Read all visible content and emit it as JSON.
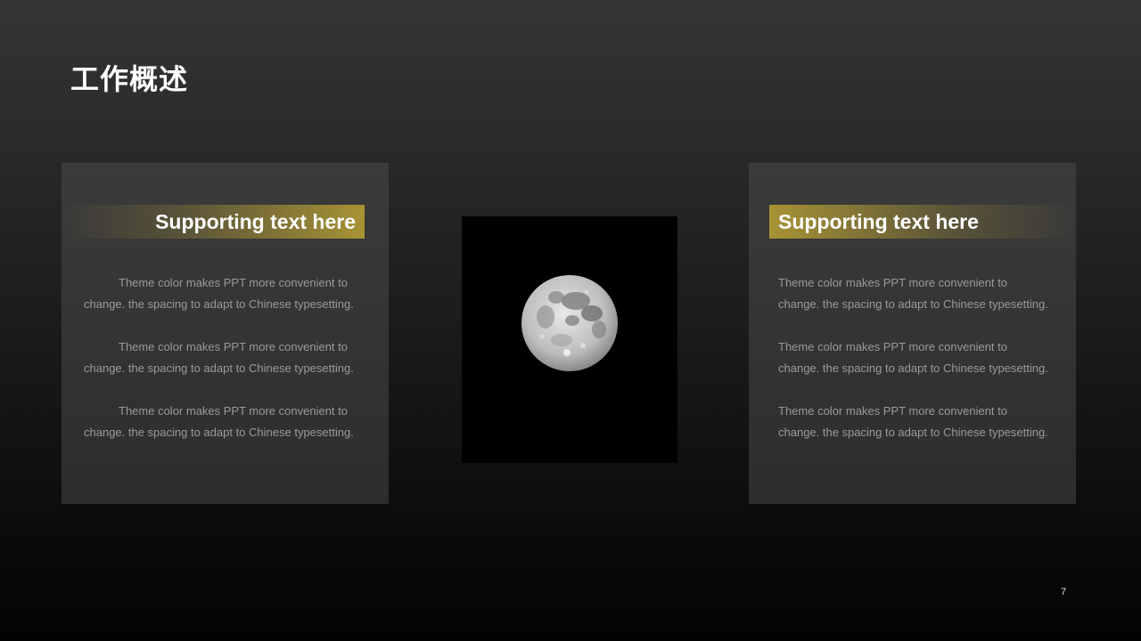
{
  "slide": {
    "title": "工作概述",
    "page_number": "7"
  },
  "left_panel": {
    "heading": "Supporting text here",
    "paragraphs": [
      {
        "line1": "Theme  color makes PPT more convenient  to",
        "line2": "change. the spacing to adapt to Chinese typesetting."
      },
      {
        "line1": "Theme  color makes PPT more convenient  to",
        "line2": "change. the spacing to adapt to Chinese typesetting."
      },
      {
        "line1": "Theme  color makes PPT more convenient  to",
        "line2": "change. the spacing to adapt to Chinese typesetting."
      }
    ]
  },
  "right_panel": {
    "heading": "Supporting text here",
    "paragraphs": [
      {
        "line1": "Theme  color makes PPT more convenient  to",
        "line2": "change. the spacing to adapt to Chinese typesetting."
      },
      {
        "line1": "Theme  color makes PPT more convenient  to",
        "line2": "change. the spacing to adapt to Chinese typesetting."
      },
      {
        "line1": "Theme  color makes PPT more convenient  to",
        "line2": "change. the spacing to adapt to Chinese typesetting."
      }
    ]
  },
  "center_image": {
    "icon": "full-moon-photo"
  },
  "colors": {
    "accent_gold": "#a89335",
    "background_top": "#353535",
    "background_bottom": "#030303",
    "body_text": "#9a9a9a"
  }
}
